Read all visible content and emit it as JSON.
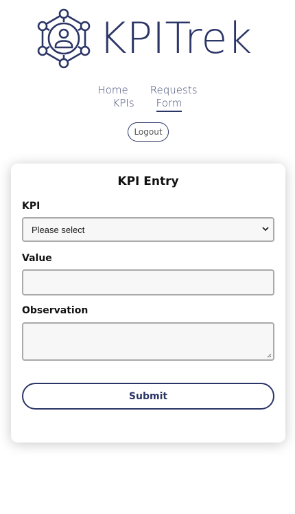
{
  "brand": {
    "name": "KPITrek",
    "color": "#2b3566"
  },
  "nav": {
    "items": [
      {
        "label": "Home"
      },
      {
        "label": "Requests"
      },
      {
        "label": "KPIs"
      },
      {
        "label": "Form"
      }
    ],
    "active": "Form"
  },
  "logout_label": "Logout",
  "form": {
    "title": "KPI Entry",
    "kpi": {
      "label": "KPI",
      "selected": "Please select"
    },
    "value": {
      "label": "Value",
      "value": ""
    },
    "observation": {
      "label": "Observation",
      "value": ""
    },
    "submit_label": "Submit"
  },
  "icons": {
    "logo": "network-user-icon",
    "select_arrow": "chevron-down-icon",
    "resize": "resize-grip-icon"
  }
}
